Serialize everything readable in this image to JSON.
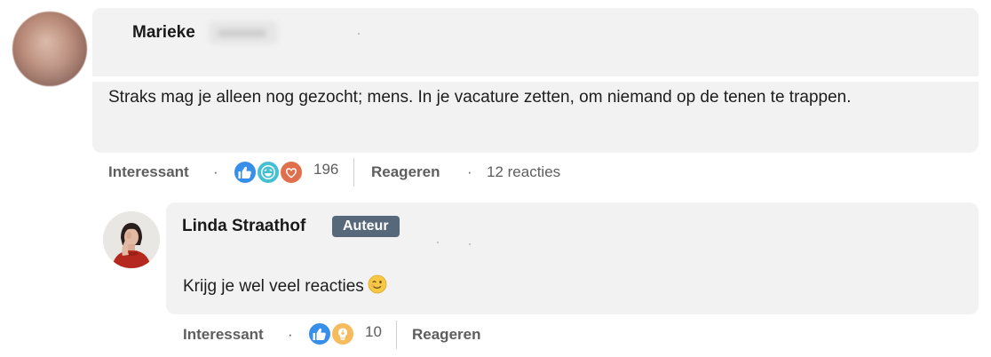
{
  "comments": [
    {
      "author_name": "Marieke",
      "text": "Straks mag je alleen nog gezocht; mens. In je vacature zetten, om niemand op de tenen te trappen.",
      "actions": {
        "like_label": "Interessant",
        "reaction_count": "196",
        "reply_label": "Reageren",
        "replies_count_label": "12 reacties"
      },
      "reactions": [
        "like-icon",
        "laugh-icon",
        "love-icon"
      ]
    },
    {
      "author_name": "Linda Straathof",
      "badge": "Auteur",
      "text": "Krijg je wel veel reacties",
      "emoji": "😉",
      "actions": {
        "like_label": "Interessant",
        "reaction_count": "10",
        "reply_label": "Reageren"
      },
      "reactions": [
        "like-icon",
        "insightful-icon"
      ]
    }
  ],
  "colors": {
    "bubble": "#f2f2f2",
    "badge": "#56687a",
    "like": "#378fe9",
    "love": "#df704d",
    "insightful": "#f5bb5c",
    "laugh": "#44bfd3"
  }
}
